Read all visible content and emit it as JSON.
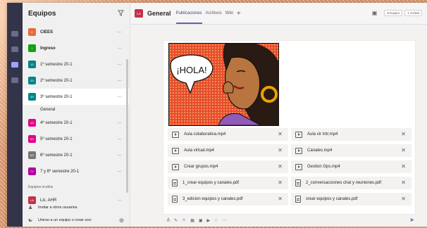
{
  "sidebar": {
    "title": "Equipos",
    "filter_icon": "filter-icon",
    "teams": [
      {
        "name": "CIEES",
        "initials": "C",
        "color": "#e86a3a",
        "bold": true
      },
      {
        "name": "Ingreso",
        "initials": "I",
        "color": "#13a10e",
        "bold": true
      },
      {
        "name": "1º semestre 20-1",
        "initials": "1S",
        "color": "#038387",
        "bold": false
      },
      {
        "name": "2º semestre 20-1",
        "initials": "2S",
        "color": "#038387",
        "bold": false
      },
      {
        "name": "3º semestre 20-1",
        "initials": "3S",
        "color": "#038387",
        "bold": false,
        "channel": "General"
      },
      {
        "name": "4º semestre 20-1",
        "initials": "4S",
        "color": "#e3008c",
        "bold": false
      },
      {
        "name": "5º semestre 20-1",
        "initials": "5S",
        "color": "#e3008c",
        "bold": false
      },
      {
        "name": "6º semestre 20-1",
        "initials": "6S",
        "color": "#7a7574",
        "bold": false
      },
      {
        "name": "7 y 8º semestre 20-1",
        "initials": "7Y",
        "color": "#b4009e",
        "bold": false
      }
    ],
    "hidden_label": "Equipos ocultos",
    "hidden_teams": [
      {
        "name": "Lic. AHR",
        "initials": "LA",
        "color": "#c4314b"
      }
    ],
    "invite_label": "Invitar a otros usuarios",
    "join_label": "Unirse a un equipo o crear uno"
  },
  "channel": {
    "avatar": "LA",
    "title": "General",
    "tabs": [
      "Publicaciones",
      "Archivos",
      "Wiki"
    ],
    "active_tab": "Publicaciones",
    "team_badge": "Equipo",
    "guest_badge": "1 invitad"
  },
  "post": {
    "image_text": "¡HOLA!",
    "files": [
      {
        "name": "Aula colaborativa.mp4",
        "type": "video"
      },
      {
        "name": "Aula vir Intr.mp4",
        "type": "video"
      },
      {
        "name": "Aula virtual.mp4",
        "type": "video"
      },
      {
        "name": "Canales.mp4",
        "type": "video"
      },
      {
        "name": "Crear grupos.mp4",
        "type": "video"
      },
      {
        "name": "Gestion Gps.mp4",
        "type": "video"
      },
      {
        "name": "1_crear equipos y canales.pdf",
        "type": "pdf"
      },
      {
        "name": "2_conversacciones chat y reuniones.pdf",
        "type": "pdf"
      },
      {
        "name": "3_edicion equipos y canales.pdf",
        "type": "pdf"
      },
      {
        "name": "crear equipos y canales.pdf",
        "type": "pdf"
      }
    ]
  }
}
